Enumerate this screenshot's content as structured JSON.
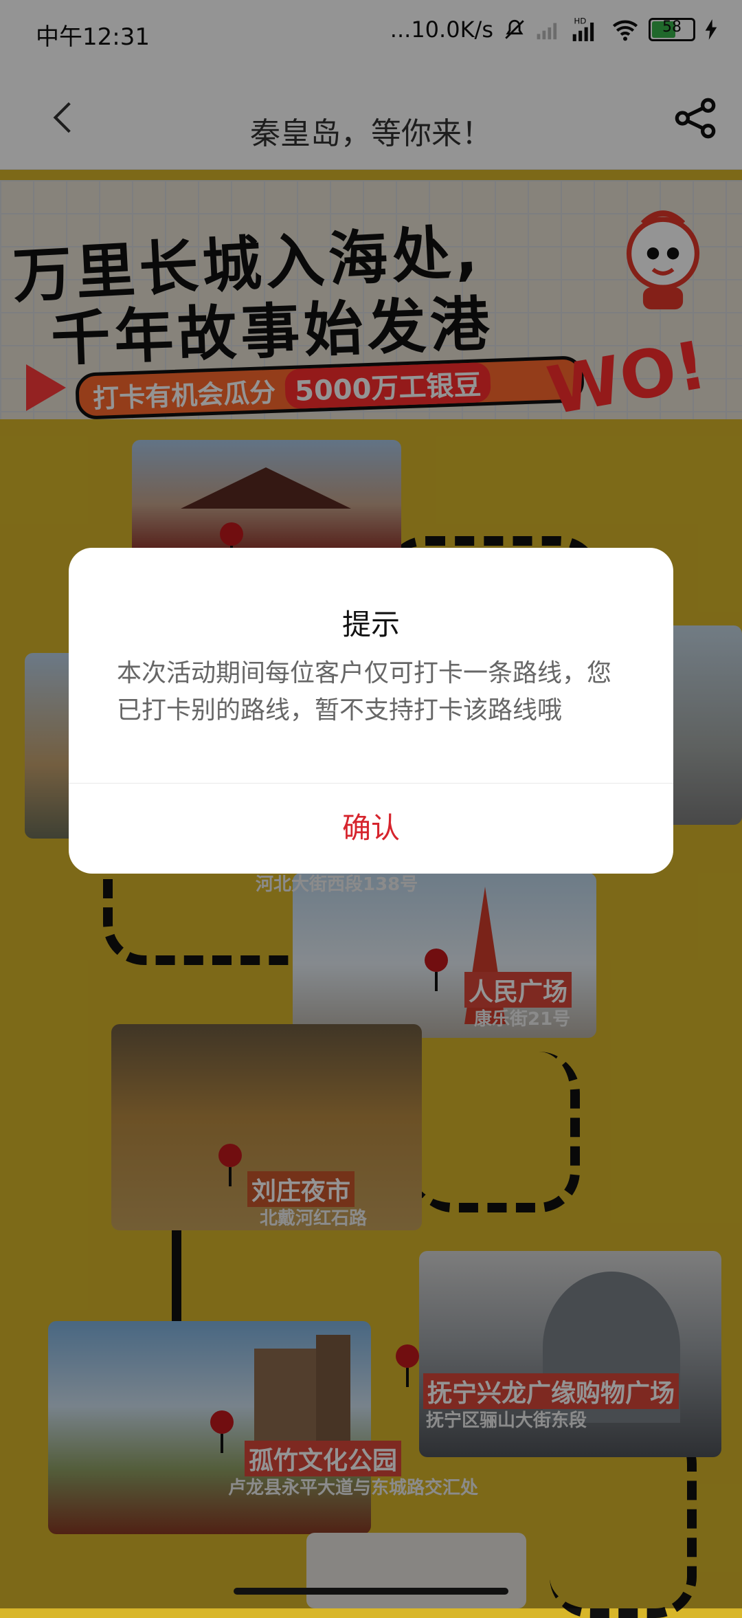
{
  "status_bar": {
    "time": "中午12:31",
    "net_speed": "...10.0K/s",
    "signal_hd": "HD",
    "battery": "58"
  },
  "nav": {
    "title": "秦皇岛，等你来！"
  },
  "banner": {
    "headline_1": "万里长城入海处,",
    "headline_2": "千年故事始发港",
    "promo_text": "打卡有机会瓜分",
    "promo_amount": "5000万工银豆",
    "badge": "WO!"
  },
  "route": {
    "stops": [
      {
        "name": "",
        "address": "河北大街西段138号"
      },
      {
        "name": "人民广场",
        "address": "康乐街21号"
      },
      {
        "name": "刘庄夜市",
        "address": "北戴河红石路"
      },
      {
        "name": "抚宁兴龙广缘购物广场",
        "address": "抚宁区骊山大街东段"
      },
      {
        "name": "孤竹文化公园",
        "address": "卢龙县永平大道与东城路交汇处"
      }
    ]
  },
  "dialog": {
    "title": "提示",
    "message": "本次活动期间每位客户仅可打卡一条路线，您已打卡别的路线，暂不支持打卡该路线哦",
    "confirm": "确认"
  },
  "colors": {
    "map_bg": "#d8b62a",
    "accent_red": "#d6242d",
    "pin_red": "#c3191d"
  },
  "icons": [
    "back-arrow-icon",
    "share-icon",
    "wifi-icon",
    "signal-icon",
    "battery-icon",
    "map-pin-icon",
    "mute-icon"
  ]
}
